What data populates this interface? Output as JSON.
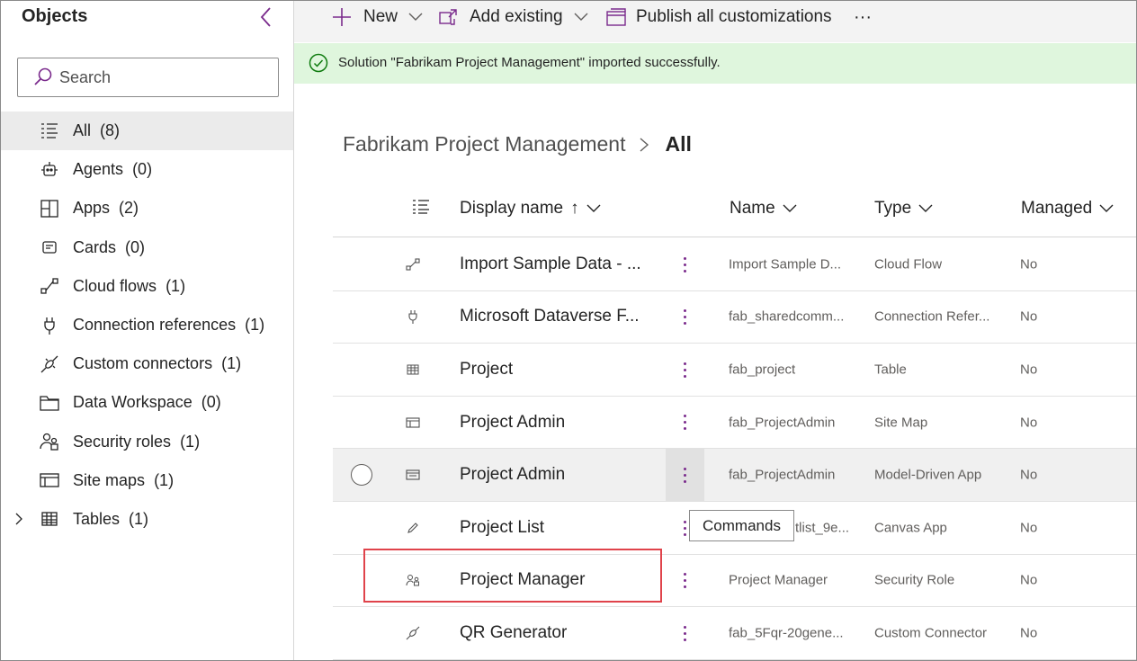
{
  "sidebar": {
    "title": "Objects",
    "search_placeholder": "Search",
    "items": [
      {
        "label": "All",
        "count": "(8)",
        "icon": "list-icon"
      },
      {
        "label": "Agents",
        "count": "(0)",
        "icon": "bot-icon"
      },
      {
        "label": "Apps",
        "count": "(2)",
        "icon": "apps-icon"
      },
      {
        "label": "Cards",
        "count": "(0)",
        "icon": "card-icon"
      },
      {
        "label": "Cloud flows",
        "count": "(1)",
        "icon": "flow-icon"
      },
      {
        "label": "Connection references",
        "count": "(1)",
        "icon": "plug-icon"
      },
      {
        "label": "Custom connectors",
        "count": "(1)",
        "icon": "connector-icon"
      },
      {
        "label": "Data Workspace",
        "count": "(0)",
        "icon": "folder-icon"
      },
      {
        "label": "Security roles",
        "count": "(1)",
        "icon": "people-icon"
      },
      {
        "label": "Site maps",
        "count": "(1)",
        "icon": "sitemap-icon"
      },
      {
        "label": "Tables",
        "count": "(1)",
        "icon": "table-icon"
      }
    ]
  },
  "toolbar": {
    "new_label": "New",
    "add_existing_label": "Add existing",
    "publish_label": "Publish all customizations",
    "more_label": "···"
  },
  "banner": {
    "message": "Solution \"Fabrikam Project Management\" imported successfully."
  },
  "breadcrumb": {
    "root": "Fabrikam Project Management",
    "current": "All"
  },
  "grid": {
    "columns": {
      "display_name": "Display name",
      "display_sort": "↑",
      "name": "Name",
      "type": "Type",
      "managed": "Managed"
    },
    "rows": [
      {
        "display": "Import Sample Data - ...",
        "name": "Import Sample D...",
        "type": "Cloud Flow",
        "managed": "No",
        "icon": "flow-icon"
      },
      {
        "display": "Microsoft Dataverse F...",
        "name": "fab_sharedcomm...",
        "type": "Connection Refer...",
        "managed": "No",
        "icon": "plug-icon"
      },
      {
        "display": "Project",
        "name": "fab_project",
        "type": "Table",
        "managed": "No",
        "icon": "table-icon"
      },
      {
        "display": "Project Admin",
        "name": "fab_ProjectAdmin",
        "type": "Site Map",
        "managed": "No",
        "icon": "sitemap-icon"
      },
      {
        "display": "Project Admin",
        "name": "fab_ProjectAdmin",
        "type": "Model-Driven App",
        "managed": "No",
        "icon": "model-app-icon"
      },
      {
        "display": "Project List",
        "name": "tlist_9e...",
        "type": "Canvas App",
        "managed": "No",
        "icon": "pen-icon"
      },
      {
        "display": "Project Manager",
        "name": "Project Manager",
        "type": "Security Role",
        "managed": "No",
        "icon": "people-icon"
      },
      {
        "display": "QR Generator",
        "name": "fab_5Fqr-20gene...",
        "type": "Custom Connector",
        "managed": "No",
        "icon": "connector-icon"
      }
    ]
  },
  "tooltip": {
    "text": "Commands"
  },
  "colors": {
    "accent": "#7a2a8c",
    "banner_bg": "#dff6dd",
    "success": "#107c10",
    "highlight": "#e0434b"
  }
}
